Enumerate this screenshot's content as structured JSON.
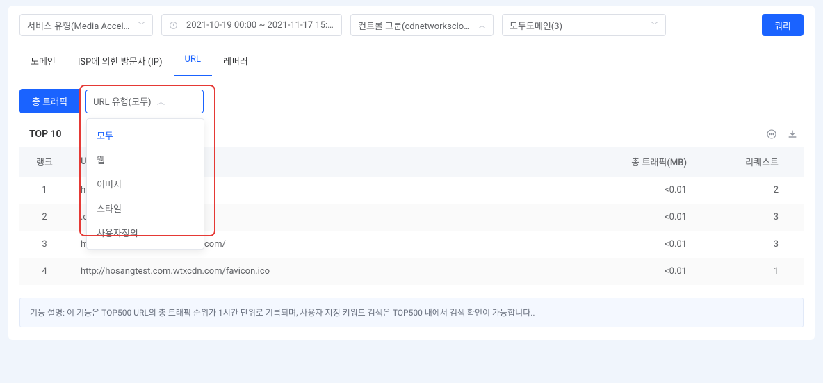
{
  "filters": {
    "serviceType": "서비스 유형(Media Accele…",
    "timeRange": "2021-10-19 00:00 ~ 2021-11-17 15:08",
    "controlGroup": "컨트롤 그룹(cdnetworksclou…",
    "domain": "모두도메인(3)",
    "queryBtn": "쿼리"
  },
  "tabs": [
    "도메인",
    "ISP에 의한 방문자 (IP)",
    "URL",
    "레퍼러"
  ],
  "activeTab": 2,
  "subFilter": {
    "pill": "총 트래픽",
    "urlTypeLabel": "URL 유형(모두)",
    "options": [
      "모두",
      "웹",
      "이미지",
      "스타일",
      "사용자정의"
    ],
    "selectedOption": 0
  },
  "top10Title": "TOP 10",
  "tableHeaders": {
    "rank": "랭크",
    "url": "U",
    "traffic": "총 트래픽(MB)",
    "requests": "리퀘스트"
  },
  "rows": [
    {
      "rank": 1,
      "url": "h                                     .com/index.html",
      "traffic": "<0.01",
      "requests": 2
    },
    {
      "rank": 2,
      "url": "                                       .com/",
      "traffic": "<0.01",
      "requests": 3
    },
    {
      "rank": 3,
      "url": "http://hosangtest.com.wtxcdn.com/",
      "traffic": "<0.01",
      "requests": 3
    },
    {
      "rank": 4,
      "url": "http://hosangtest.com.wtxcdn.com/favicon.ico",
      "traffic": "<0.01",
      "requests": 1
    }
  ],
  "infoBanner": "기능 설명: 이 기능은 TOP500 URL의 총 트래픽 순위가 1시간 단위로 기록되며, 사용자 지정 키워드 검색은 TOP500 내에서 검색 확인이 가능합니다.."
}
